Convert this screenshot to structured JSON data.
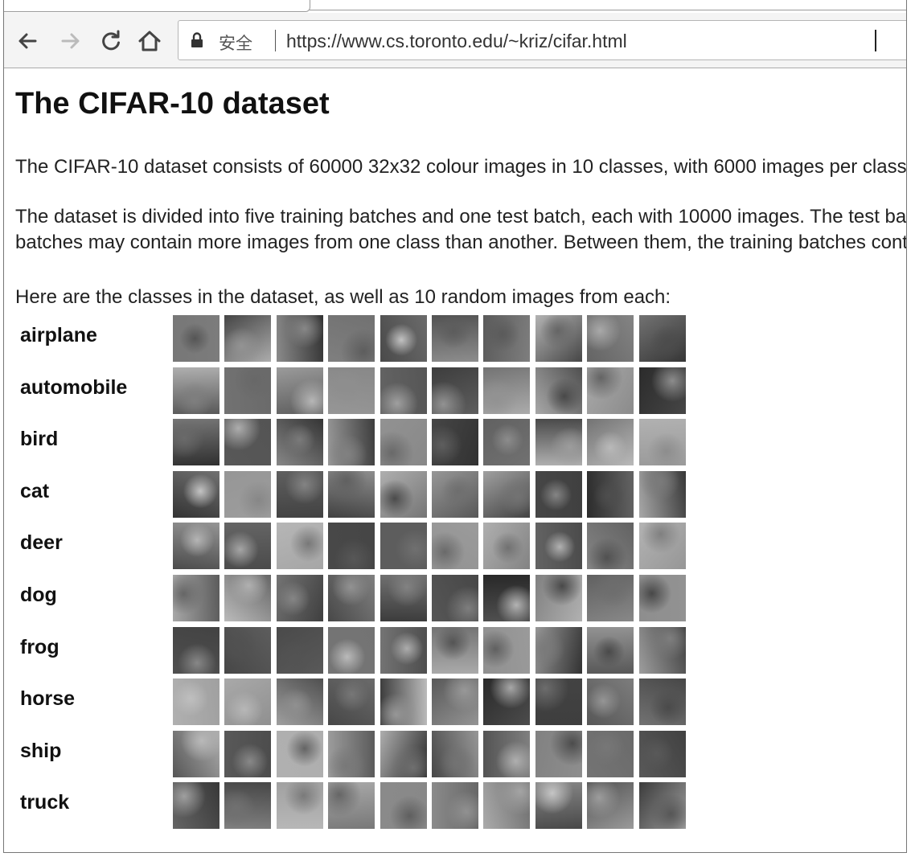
{
  "browser": {
    "security_label": "安全",
    "url": "https://www.cs.toronto.edu/~kriz/cifar.html",
    "icons": [
      "back-arrow-icon",
      "forward-arrow-icon",
      "reload-icon",
      "home-icon",
      "lock-icon"
    ]
  },
  "page": {
    "title": "The CIFAR-10 dataset",
    "para1": "The CIFAR-10 dataset consists of 60000 32x32 colour images in 10 classes, with 6000 images per class",
    "para2_line1": "The dataset is divided into five training batches and one test batch, each with 10000 images. The test batch",
    "para2_line2": "batches may contain more images from one class than another. Between them, the training batches contain",
    "para3": "Here are the classes in the dataset, as well as 10 random images from each:"
  },
  "classes": [
    {
      "label": "airplane"
    },
    {
      "label": "automobile"
    },
    {
      "label": "bird"
    },
    {
      "label": "cat"
    },
    {
      "label": "deer"
    },
    {
      "label": "dog"
    },
    {
      "label": "frog"
    },
    {
      "label": "horse"
    },
    {
      "label": "ship"
    },
    {
      "label": "truck"
    }
  ]
}
